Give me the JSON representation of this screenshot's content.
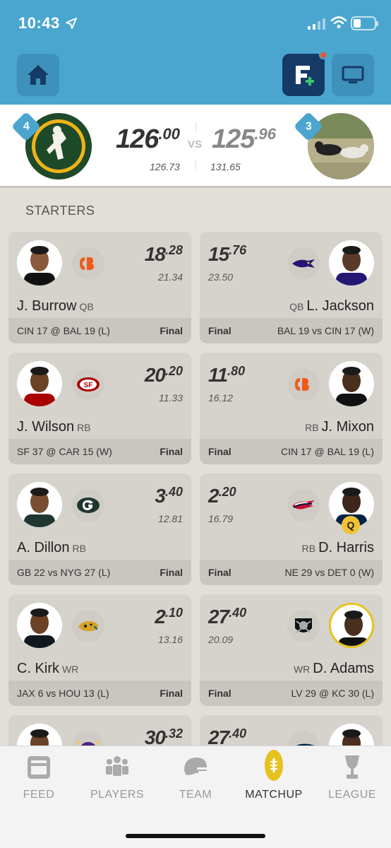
{
  "status": {
    "time": "10:43"
  },
  "header": {
    "home_icon": "home-icon",
    "fantasy_icon": "fantasy-add-icon",
    "tv_icon": "tv-icon"
  },
  "matchup": {
    "left": {
      "rank": "4",
      "score_int": "126",
      "score_dec": ".00",
      "projected": "126.73"
    },
    "right": {
      "rank": "3",
      "score_int": "125",
      "score_dec": ".96",
      "projected": "131.65"
    },
    "vs": "VS"
  },
  "section_title": "STARTERS",
  "players": [
    {
      "side": "left",
      "name": "J. Burrow",
      "pos": "QB",
      "pts_int": "18",
      "pts_dec": ".28",
      "proj": "21.34",
      "game": "CIN 17 @ BAL 19 (L)",
      "status": "Final",
      "team": "CIN"
    },
    {
      "side": "right",
      "name": "L. Jackson",
      "pos": "QB",
      "pts_int": "15",
      "pts_dec": ".76",
      "proj": "23.50",
      "game": "BAL 19 vs CIN 17 (W)",
      "status": "Final",
      "team": "BAL"
    },
    {
      "side": "left",
      "name": "J. Wilson",
      "pos": "RB",
      "pts_int": "20",
      "pts_dec": ".20",
      "proj": "11.33",
      "game": "SF 37 @ CAR 15 (W)",
      "status": "Final",
      "team": "SF"
    },
    {
      "side": "right",
      "name": "J. Mixon",
      "pos": "RB",
      "pts_int": "11",
      "pts_dec": ".80",
      "proj": "16.12",
      "game": "CIN 17 @ BAL 19 (L)",
      "status": "Final",
      "team": "CIN"
    },
    {
      "side": "left",
      "name": "A. Dillon",
      "pos": "RB",
      "pts_int": "3",
      "pts_dec": ".40",
      "proj": "12.81",
      "game": "GB 22 vs NYG 27 (L)",
      "status": "Final",
      "team": "GB"
    },
    {
      "side": "right",
      "name": "D. Harris",
      "pos": "RB",
      "pts_int": "2",
      "pts_dec": ".20",
      "proj": "16.79",
      "game": "NE 29 vs DET 0 (W)",
      "status": "Final",
      "team": "NE",
      "injury": "Q"
    },
    {
      "side": "left",
      "name": "C. Kirk",
      "pos": "WR",
      "pts_int": "2",
      "pts_dec": ".10",
      "proj": "13.16",
      "game": "JAX 6 vs HOU 13 (L)",
      "status": "Final",
      "team": "JAX"
    },
    {
      "side": "right",
      "name": "D. Adams",
      "pos": "WR",
      "pts_int": "27",
      "pts_dec": ".40",
      "proj": "20.09",
      "game": "LV 29 @ KC 30 (L)",
      "status": "Final",
      "team": "LV"
    },
    {
      "side": "left",
      "pts_int": "30",
      "pts_dec": ".32",
      "team": "MIN"
    },
    {
      "side": "right",
      "pts_int": "27",
      "pts_dec": ".40",
      "team": "SEA"
    }
  ],
  "tabs": [
    {
      "label": "FEED",
      "icon": "feed-icon",
      "active": false
    },
    {
      "label": "PLAYERS",
      "icon": "players-icon",
      "active": false
    },
    {
      "label": "TEAM",
      "icon": "helmet-icon",
      "active": false
    },
    {
      "label": "MATCHUP",
      "icon": "football-icon",
      "active": true
    },
    {
      "label": "LEAGUE",
      "icon": "trophy-icon",
      "active": false
    }
  ],
  "colors": {
    "header": "#4aa6cf",
    "accent": "#163a66",
    "active_tab": "#e6c21f"
  }
}
